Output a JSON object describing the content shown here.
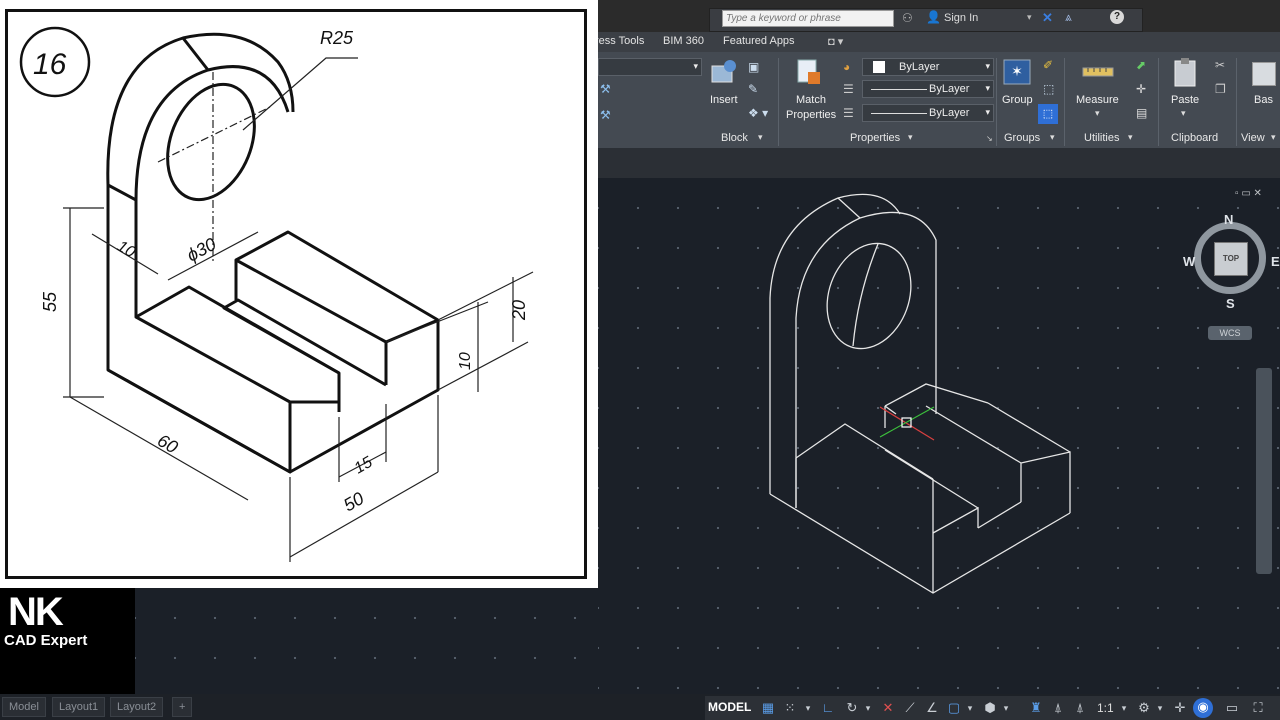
{
  "titlebar": {
    "search_placeholder": "Type a keyword or phrase",
    "sign_in": "Sign In",
    "help_icon": "?"
  },
  "ribbon": {
    "tabs": [
      "ress Tools",
      "BIM 360",
      "Featured Apps"
    ],
    "buttons": {
      "insert": "Insert",
      "match_properties_line1": "Match",
      "match_properties_line2": "Properties",
      "group": "Group",
      "measure": "Measure",
      "paste": "Paste",
      "base": "Bas"
    },
    "combos": {
      "color": "ByLayer",
      "linetype": "ByLayer",
      "lineweight": "ByLayer"
    },
    "panels": {
      "block": "Block",
      "properties": "Properties",
      "groups": "Groups",
      "utilities": "Utilities",
      "clipboard": "Clipboard",
      "view": "View"
    }
  },
  "viewcube": {
    "north": "N",
    "south": "S",
    "east": "E",
    "west": "W",
    "face": "TOP",
    "wcs": "WCS"
  },
  "reference": {
    "number": "16",
    "dimensions": {
      "r25": "R25",
      "d30": "ϕ30",
      "d10_wall": "10",
      "d55": "55",
      "d60": "60",
      "d20": "20",
      "d10_height": "10",
      "d15": "15",
      "d50": "50"
    }
  },
  "logo": {
    "initials": "NK",
    "name": "CAD Expert"
  },
  "statusbar": {
    "model": "MODEL",
    "scale": "1:1",
    "layouts": [
      "Model",
      "Layout1",
      "Layout2"
    ],
    "add_tab": "+"
  },
  "colors": {
    "canvas": "#1b2028",
    "ribbon": "#444a52",
    "highlight": "#2f6fd6"
  }
}
